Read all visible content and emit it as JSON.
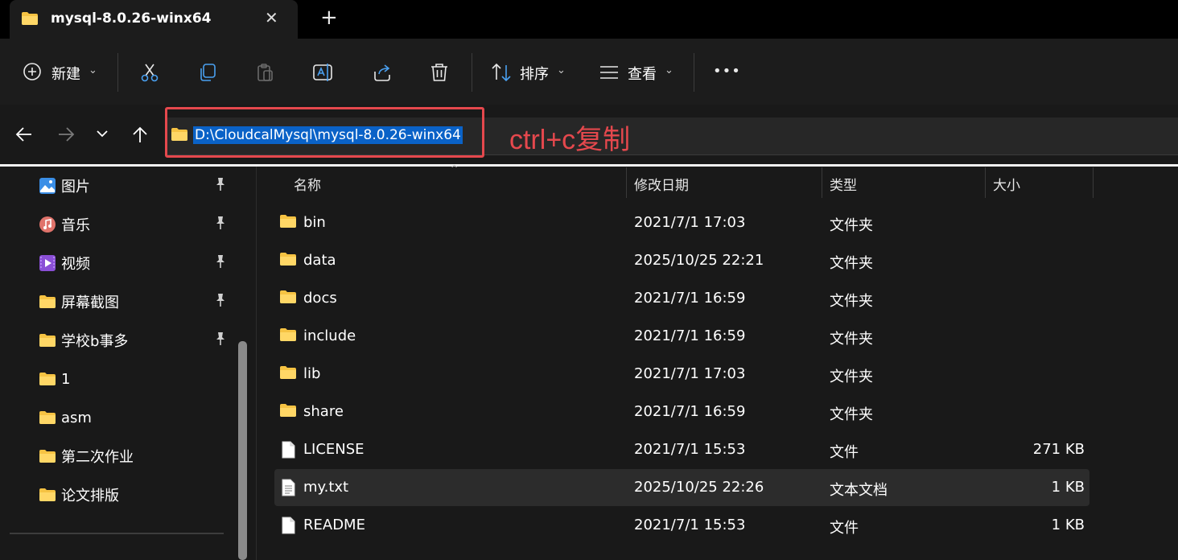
{
  "tab": {
    "title": "mysql-8.0.26-winx64",
    "close": "✕",
    "new_tab": "+"
  },
  "toolbar": {
    "new_label": "新建",
    "sort_label": "排序",
    "view_label": "查看",
    "more_label": "•••"
  },
  "address": {
    "path": "D:\\CloudcalMysql\\mysql-8.0.26-winx64",
    "annotation": "ctrl+c复制"
  },
  "sidebar": {
    "items": [
      {
        "label": "图片",
        "icon": "pictures-icon",
        "pinned": true
      },
      {
        "label": "音乐",
        "icon": "music-icon",
        "pinned": true
      },
      {
        "label": "视频",
        "icon": "video-icon",
        "pinned": true
      },
      {
        "label": "屏幕截图",
        "icon": "folder-icon",
        "pinned": true
      },
      {
        "label": "学校b事多",
        "icon": "folder-icon",
        "pinned": true
      },
      {
        "label": "1",
        "icon": "folder-icon",
        "pinned": false
      },
      {
        "label": "asm",
        "icon": "folder-icon",
        "pinned": false
      },
      {
        "label": "第二次作业",
        "icon": "folder-icon",
        "pinned": false
      },
      {
        "label": "论文排版",
        "icon": "folder-icon",
        "pinned": false
      }
    ]
  },
  "columns": {
    "name": "名称",
    "date": "修改日期",
    "type": "类型",
    "size": "大小"
  },
  "files": [
    {
      "name": "bin",
      "date": "2021/7/1 17:03",
      "type": "文件夹",
      "size": "",
      "icon": "folder-icon"
    },
    {
      "name": "data",
      "date": "2025/10/25 22:21",
      "type": "文件夹",
      "size": "",
      "icon": "folder-icon"
    },
    {
      "name": "docs",
      "date": "2021/7/1 16:59",
      "type": "文件夹",
      "size": "",
      "icon": "folder-icon"
    },
    {
      "name": "include",
      "date": "2021/7/1 16:59",
      "type": "文件夹",
      "size": "",
      "icon": "folder-icon"
    },
    {
      "name": "lib",
      "date": "2021/7/1 17:03",
      "type": "文件夹",
      "size": "",
      "icon": "folder-icon"
    },
    {
      "name": "share",
      "date": "2021/7/1 16:59",
      "type": "文件夹",
      "size": "",
      "icon": "folder-icon"
    },
    {
      "name": "LICENSE",
      "date": "2021/7/1 15:53",
      "type": "文件",
      "size": "271 KB",
      "icon": "file-icon"
    },
    {
      "name": "my.txt",
      "date": "2025/10/25 22:26",
      "type": "文本文档",
      "size": "1 KB",
      "icon": "text-file-icon",
      "selected": true
    },
    {
      "name": "README",
      "date": "2021/7/1 15:53",
      "type": "文件",
      "size": "1 KB",
      "icon": "file-icon"
    }
  ],
  "colors": {
    "accent": "#0a62c7",
    "annotation_red": "#e5484d",
    "folder_yellow": "#f6c343"
  }
}
